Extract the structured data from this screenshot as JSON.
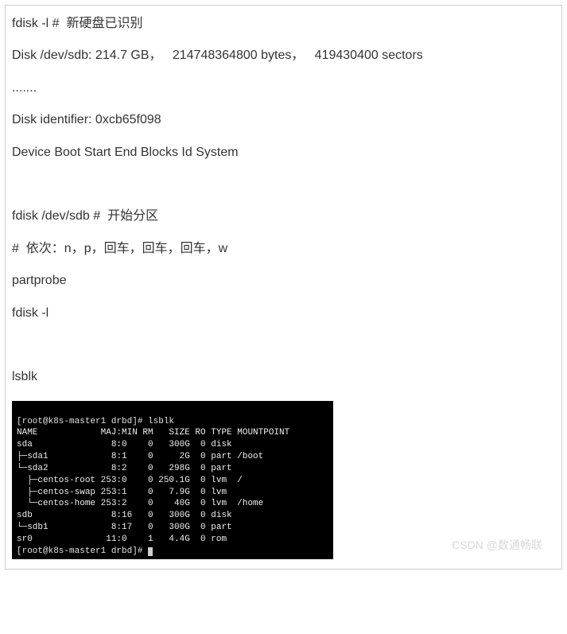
{
  "text": {
    "l1": "fdisk -l #  新硬盘已识别",
    "l2": "Disk /dev/sdb: 214.7 GB，   214748364800 bytes，   419430400 sectors",
    "l3": ".......",
    "l4": "Disk identifier: 0xcb65f098",
    "l5": "Device Boot Start End Blocks Id System",
    "l6": "fdisk /dev/sdb #  开始分区",
    "l7": "#  依次：n，p，回车，回车，回车，w",
    "l8": "partprobe",
    "l9": "fdisk -l",
    "l10": "lsblk"
  },
  "terminal": {
    "prompt1": "[root@k8s-master1 drbd]# lsblk",
    "header": "NAME            MAJ:MIN RM   SIZE RO TYPE MOUNTPOINT",
    "rows": [
      "sda               8:0    0   300G  0 disk",
      "├─sda1            8:1    0     2G  0 part /boot",
      "└─sda2            8:2    0   298G  0 part",
      "  ├─centos-root 253:0    0 250.1G  0 lvm  /",
      "  ├─centos-swap 253:1    0   7.9G  0 lvm",
      "  └─centos-home 253:2    0    40G  0 lvm  /home",
      "sdb               8:16   0   300G  0 disk",
      "└─sdb1            8:17   0   300G  0 part",
      "sr0              11:0    1   4.4G  0 rom"
    ],
    "prompt2": "[root@k8s-master1 drbd]# "
  },
  "watermark": "CSDN @数通畅联"
}
